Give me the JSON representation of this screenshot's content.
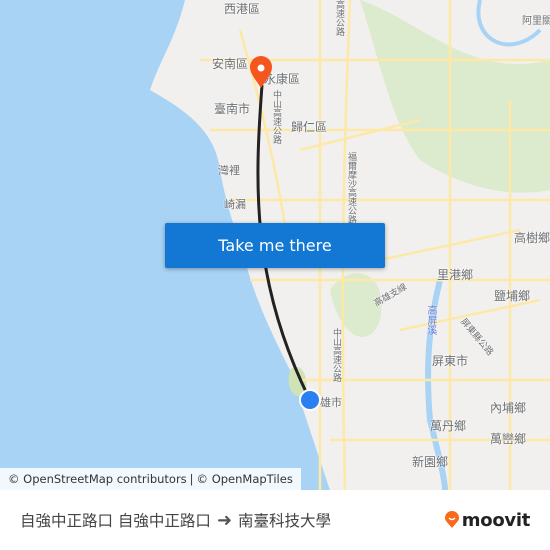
{
  "map": {
    "labels": {
      "xigang": "西港區",
      "annan": "安南區",
      "yongkang": "永康區",
      "tainan": "臺南市",
      "guiren": "歸仁區",
      "wanli": "灣裡",
      "qilou": "崎漏",
      "gaoshu": "高樹鄉",
      "ligang": "里港鄉",
      "yanpu": "鹽埔鄉",
      "pingtung": "屏東市",
      "neipu": "內埔鄉",
      "wandan": "萬丹鄉",
      "wanluan": "萬巒鄉",
      "xinyuan": "新園鄉",
      "kaohsiung": "雄市",
      "alishan": "阿里關",
      "zhongshan_hwy_north": "中山高速公路",
      "zhongshan_hwy_south": "中山高速公路",
      "formosa_hwy": "福爾摩沙高速公路",
      "kaoping_river": "高屏溪",
      "kaohsiung_branch": "高雄支線",
      "hwy_north": "高速公路",
      "pingtung_hwy": "屏東縣公路"
    },
    "colors": {
      "water": "#a8d3f5",
      "land": "#f1f0ee",
      "park": "#d7e8c4",
      "route": "#222222",
      "destination_pin": "#f5561d",
      "origin_dot": "#2a7ff3"
    }
  },
  "cta": {
    "label": "Take me there"
  },
  "attribution": {
    "osm": "© OpenStreetMap contributors",
    "sep": "|",
    "omt": "© OpenMapTiles"
  },
  "footer": {
    "origin": "自強中正路口 自強中正路口",
    "arrow_icon": "arrow-right-icon",
    "destination": "南臺科技大學",
    "brand": "moovit",
    "brand_color": "#f96a1b"
  }
}
